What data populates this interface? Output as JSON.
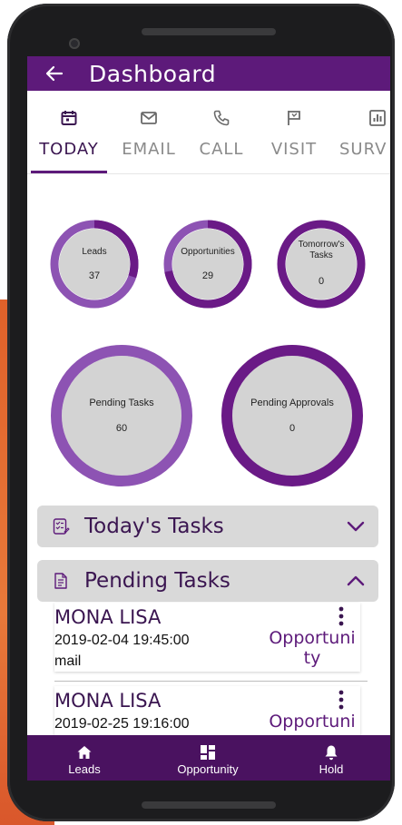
{
  "appbar": {
    "title": "Dashboard"
  },
  "tabs": [
    {
      "label": "TODAY",
      "icon": "calendar-icon",
      "active": true
    },
    {
      "label": "EMAIL",
      "icon": "mail-icon",
      "active": false
    },
    {
      "label": "CALL",
      "icon": "phone-icon",
      "active": false
    },
    {
      "label": "VISIT",
      "icon": "flag-icon",
      "active": false
    },
    {
      "label": "SURV",
      "icon": "chart-icon",
      "active": false
    }
  ],
  "gauges": {
    "leads": {
      "label": "Leads",
      "value": "37",
      "fill": 0.3
    },
    "opportunities": {
      "label": "Opportunities",
      "value": "29",
      "fill": 0.72
    },
    "tomorrow": {
      "label": "Tomorrow's Tasks",
      "value": "0",
      "fill": 0
    },
    "pending_tasks": {
      "label": "Pending Tasks",
      "value": "60",
      "fill": 1
    },
    "pending_approvals": {
      "label": "Pending Approvals",
      "value": "0",
      "fill": 0
    }
  },
  "sections": {
    "todays_tasks": {
      "title": "Today's Tasks",
      "expanded": false
    },
    "pending_tasks": {
      "title": "Pending Tasks",
      "expanded": true
    }
  },
  "pending_items": [
    {
      "name": "MONA LISA",
      "datetime": "2019-02-04 19:45:00",
      "type": "mail",
      "category": "Opportuni ty"
    },
    {
      "name": "MONA LISA",
      "datetime": "2019-02-25 19:16:00",
      "type": "",
      "category": "Opportuni"
    }
  ],
  "bottom_nav": [
    {
      "label": "Leads",
      "icon": "home-icon"
    },
    {
      "label": "Opportunity",
      "icon": "dashboard-icon"
    },
    {
      "label": "Hold",
      "icon": "bell-icon"
    }
  ],
  "colors": {
    "primary": "#5d1a7a",
    "bottom_nav": "#4a1260",
    "gauge_light": "#8d53b3",
    "gauge_dark": "#6a1a86",
    "gauge_fill_bg": "#d3d3d3",
    "section_bg": "#d9d9d9"
  }
}
